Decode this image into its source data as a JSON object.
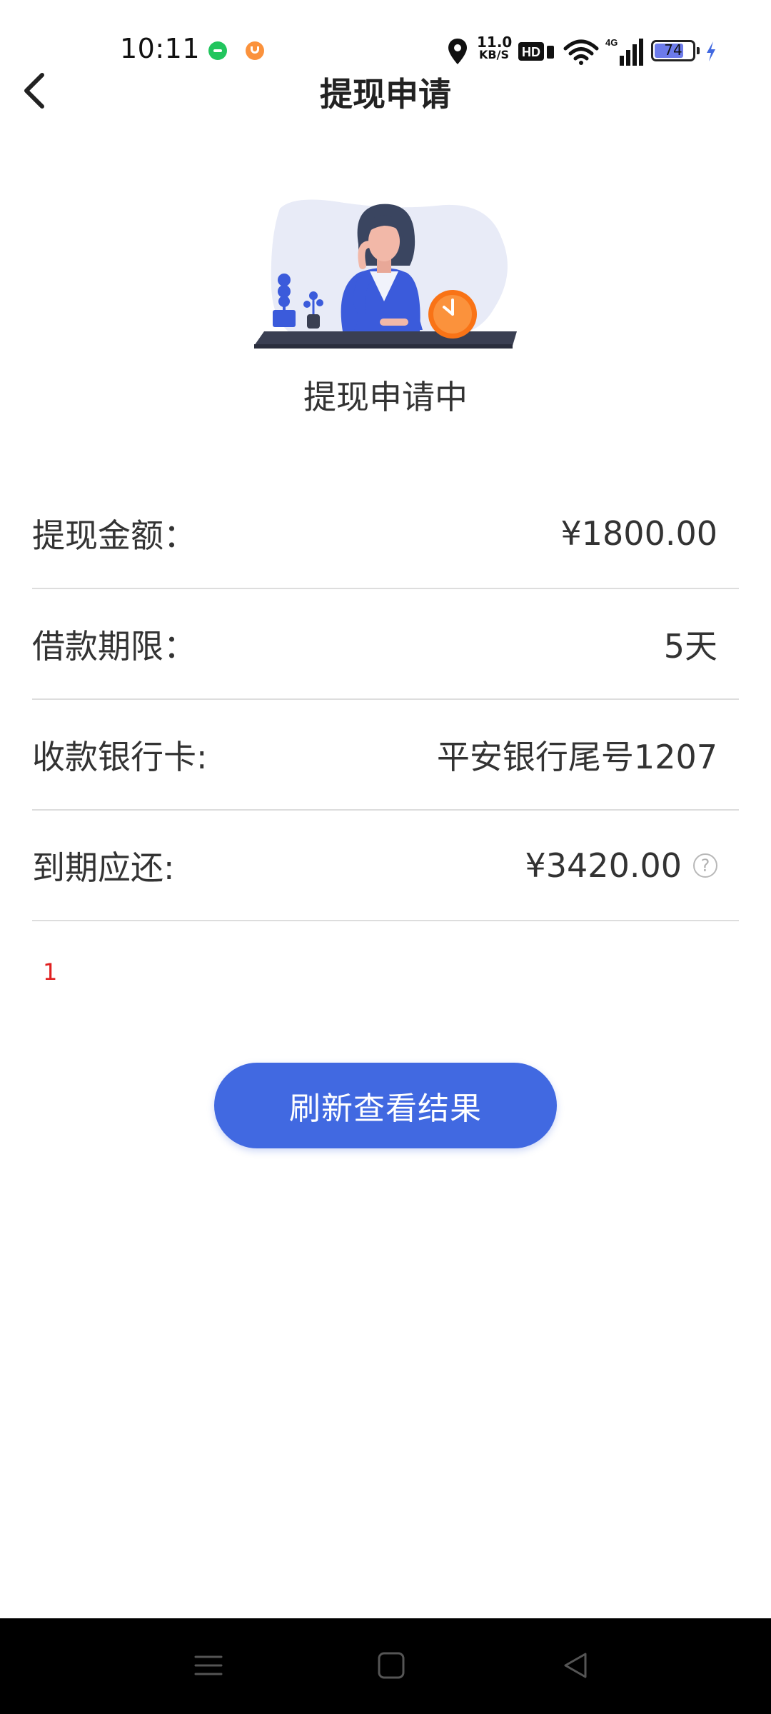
{
  "status_bar": {
    "time": "10:11",
    "net_speed_value": "11.0",
    "net_speed_unit": "KB/S",
    "battery_level": "74",
    "battery_fraction": 0.74,
    "notification_icons": [
      "green-chat-app-icon",
      "orange-app-icon"
    ],
    "right_icons": [
      "location-icon",
      "hd-icon",
      "wifi-icon",
      "4g-signal-icon",
      "battery-icon",
      "charging-icon"
    ]
  },
  "header": {
    "title": "提现申请",
    "back_icon": "chevron-left-icon"
  },
  "illustration": {
    "icon": "woman-waiting-clock-illustration",
    "accent_color": "#f97316",
    "figure_color": "#3b5bdb"
  },
  "status": {
    "text": "提现申请中"
  },
  "details": [
    {
      "label": "提现金额：",
      "value": "¥1800.00"
    },
    {
      "label": "借款期限：",
      "value": "5天"
    },
    {
      "label": "收款银行卡:",
      "value": "平安银行尾号1207"
    },
    {
      "label": "到期应还:",
      "value": "¥3420.00",
      "help_icon": "question-circle-icon"
    }
  ],
  "note": {
    "text": "1",
    "color": "#e02020"
  },
  "actions": {
    "refresh_label": "刷新查看结果",
    "button_color": "#4169e1"
  },
  "nav_bar": {
    "buttons": [
      "menu-icon",
      "home-icon",
      "back-triangle-icon"
    ]
  }
}
